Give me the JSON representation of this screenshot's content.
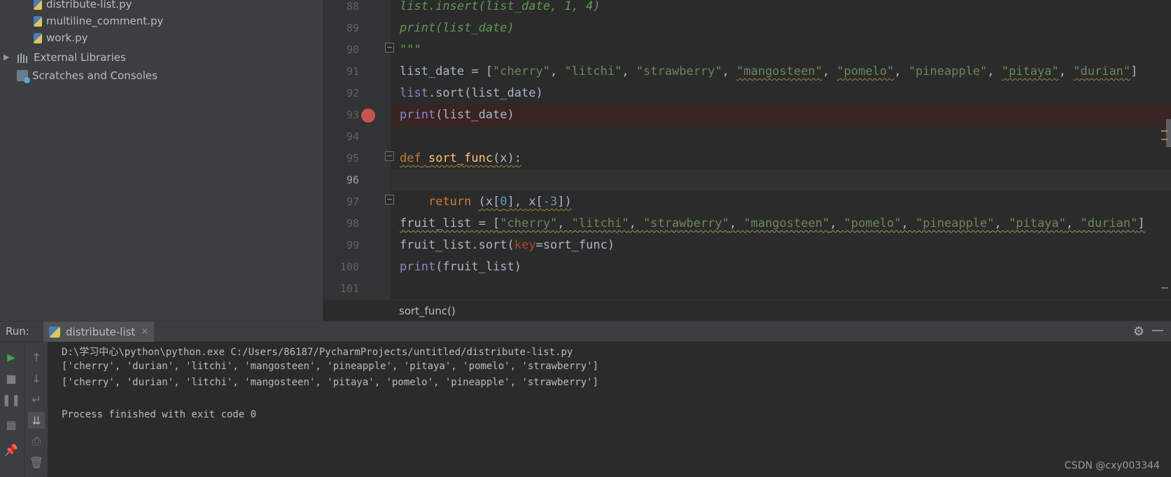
{
  "project_tree": {
    "items": [
      {
        "label": "distribute-list.py",
        "icon": "python-file-icon"
      },
      {
        "label": "multiline_comment.py",
        "icon": "python-file-icon"
      },
      {
        "label": "work.py",
        "icon": "python-file-icon"
      },
      {
        "label": "External Libraries",
        "icon": "library-icon",
        "expand_icon": "▶"
      },
      {
        "label": "Scratches and Consoles",
        "icon": "scratches-icon"
      }
    ]
  },
  "editor": {
    "line_numbers": [
      "88",
      "89",
      "90",
      "91",
      "92",
      "93",
      "94",
      "95",
      "96",
      "97",
      "98",
      "99",
      "100",
      "101"
    ],
    "breakpoint_line": "93",
    "caret_line": "96",
    "lines": {
      "l88": "list.insert(list_date, 1, 4)",
      "l89": "print(list_date)",
      "l90": "\"\"\"",
      "l91": {
        "var": "list_date = [",
        "items": [
          "\"cherry\"",
          "\"litchi\"",
          "\"strawberry\"",
          "\"mangosteen\"",
          "\"pomelo\"",
          "\"pineapple\"",
          "\"pitaya\"",
          "\"durian\""
        ],
        "sep": ", ",
        "close": "]"
      },
      "l92": {
        "obj": "list",
        "rest": ".sort(list_date)"
      },
      "l93": {
        "fn": "print",
        "rest": "(list_date)"
      },
      "l95": {
        "kw": "def",
        "name": "sort_func",
        "params": "(x):"
      },
      "l97": {
        "kw": "return",
        "expr_a": "(x[",
        "n0": "0",
        "expr_b": "], x[",
        "n1": "-3",
        "expr_c": "])"
      },
      "l98": {
        "var": "fruit_list = [",
        "items": [
          "\"cherry\"",
          "\"litchi\"",
          "\"strawberry\"",
          "\"mangosteen\"",
          "\"pomelo\"",
          "\"pineapple\"",
          "\"pitaya\"",
          "\"durian\""
        ],
        "sep": ", ",
        "close": "]"
      },
      "l99": {
        "a": "fruit_list.sort(",
        "kwarg": "key",
        "b": "=sort_func)"
      },
      "l100": {
        "fn": "print",
        "rest": "(fruit_list)"
      }
    },
    "breadcrumb": "sort_func()"
  },
  "run_panel": {
    "label": "Run:",
    "tab_label": "distribute-list",
    "close_glyph": "×",
    "console_lines": [
      "D:\\学习中心\\python\\python.exe C:/Users/86187/PycharmProjects/untitled/distribute-list.py",
      "['cherry', 'durian', 'litchi', 'mangosteen', 'pineapple', 'pitaya', 'pomelo', 'strawberry']",
      "['cherry', 'durian', 'litchi', 'mangosteen', 'pitaya', 'pomelo', 'pineapple', 'strawberry']",
      "",
      "Process finished with exit code 0"
    ]
  },
  "watermark": "CSDN @cxy003344",
  "colors": {
    "keyword": "#cc7832",
    "string": "#6a8759",
    "comment": "#629755",
    "builtin": "#8888c6",
    "number": "#6897bb",
    "breakpoint": "#c75450"
  }
}
